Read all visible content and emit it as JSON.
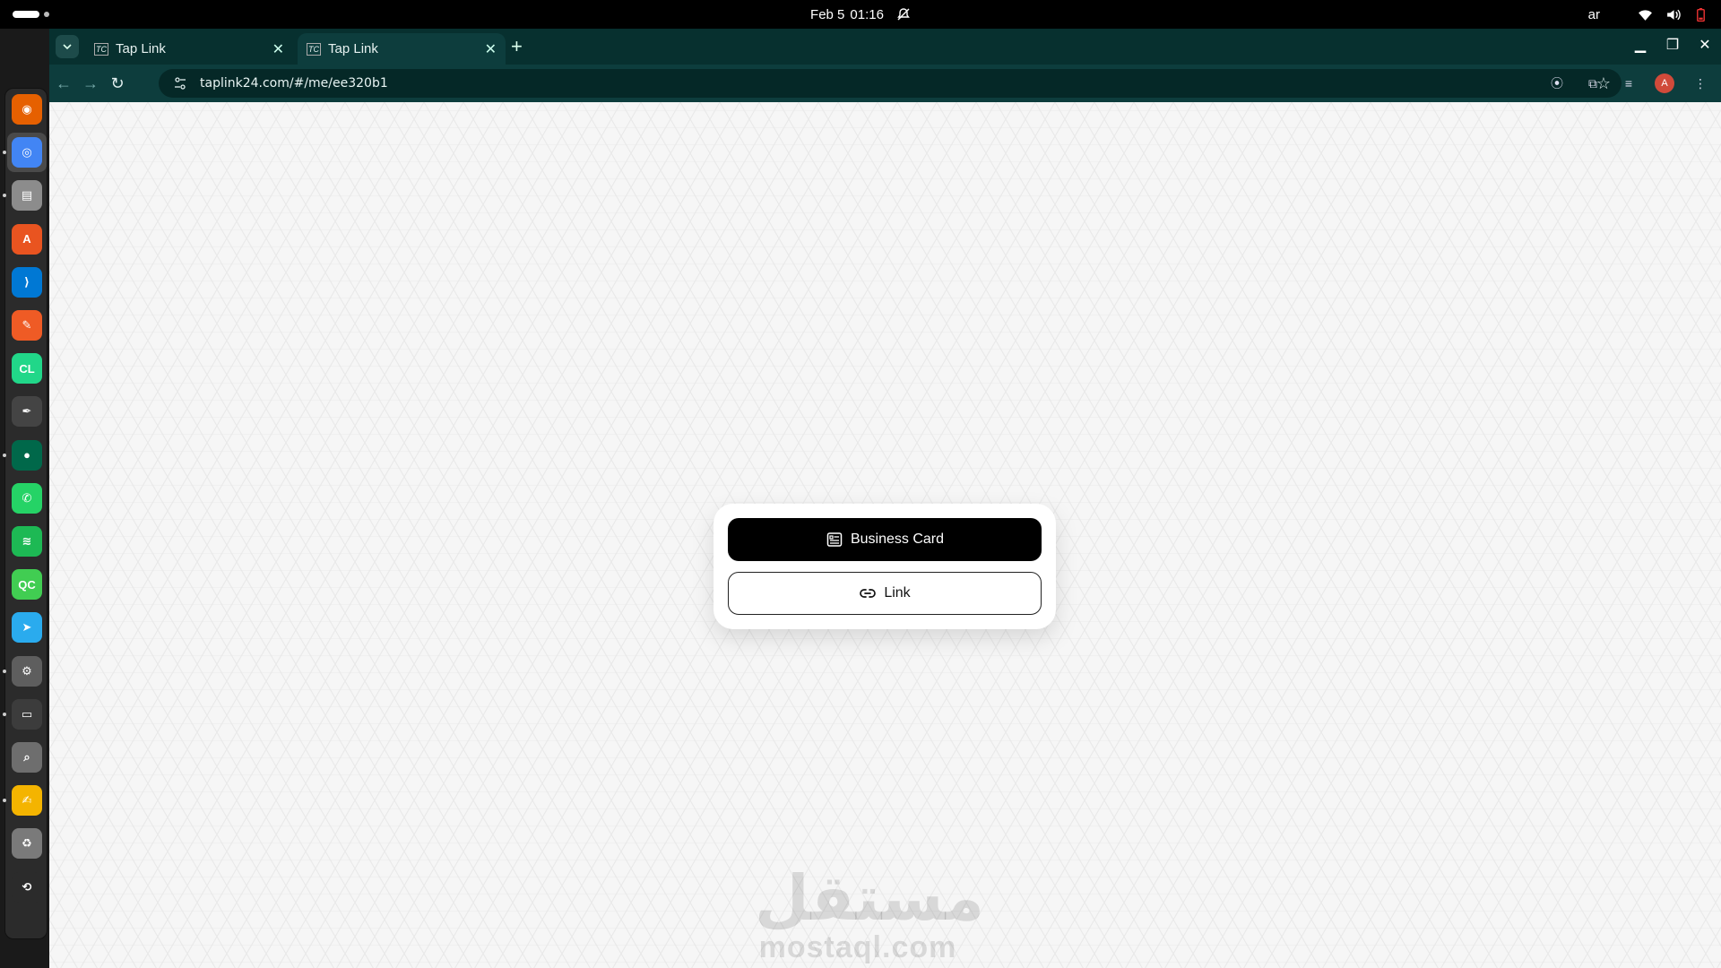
{
  "topbar": {
    "date": "Feb 5",
    "time": "01:16",
    "input_lang": "ar",
    "icons": [
      "notifications-off-icon",
      "wifi-icon",
      "volume-icon",
      "battery-icon"
    ]
  },
  "dock": {
    "apps": [
      {
        "name": "firefox",
        "color": "#e66000",
        "glyph": "◉"
      },
      {
        "name": "chrome",
        "color": "#4285f4",
        "glyph": "◎"
      },
      {
        "name": "files",
        "color": "#8c8c8c",
        "glyph": "▤"
      },
      {
        "name": "app-center",
        "color": "#e95420",
        "glyph": "A"
      },
      {
        "name": "vscode",
        "color": "#0078d4",
        "glyph": "⟩"
      },
      {
        "name": "postman",
        "color": "#ef5b25",
        "glyph": "✎"
      },
      {
        "name": "clion",
        "color": "#21d789",
        "glyph": "CL"
      },
      {
        "name": "inkscape",
        "color": "#444444",
        "glyph": "✒"
      },
      {
        "name": "mongodb-compass",
        "color": "#00684a",
        "glyph": "●"
      },
      {
        "name": "whatsapp",
        "color": "#25d366",
        "glyph": "✆"
      },
      {
        "name": "spotify",
        "color": "#1db954",
        "glyph": "≋"
      },
      {
        "name": "qt-creator",
        "color": "#41cd52",
        "glyph": "QC"
      },
      {
        "name": "telegram",
        "color": "#2aabee",
        "glyph": "➤"
      },
      {
        "name": "settings",
        "color": "#5e5e5e",
        "glyph": "⚙"
      },
      {
        "name": "terminal",
        "color": "#3c3c3c",
        "glyph": "▭"
      },
      {
        "name": "image-viewer",
        "color": "#6e6e6e",
        "glyph": "⌕"
      },
      {
        "name": "text-editor",
        "color": "#f4b400",
        "glyph": "✍"
      },
      {
        "name": "trash",
        "color": "#7a7a7a",
        "glyph": "♻"
      },
      {
        "name": "show-apps",
        "color": "#2b2b2b",
        "glyph": "⟲"
      }
    ]
  },
  "browser": {
    "tabs": [
      {
        "title": "Tap Link",
        "favicon": "TC"
      },
      {
        "title": "Tap Link",
        "favicon": "TC"
      }
    ],
    "new_tab_label": "+",
    "url": "taplink24.com/#/me/ee320b1",
    "profile_initial": "A",
    "accent": "#0d3d3d"
  },
  "page": {
    "primary_button": "Business Card",
    "secondary_button": "Link",
    "watermark_ar": "مستقل",
    "watermark_en": "mostaql.com"
  }
}
